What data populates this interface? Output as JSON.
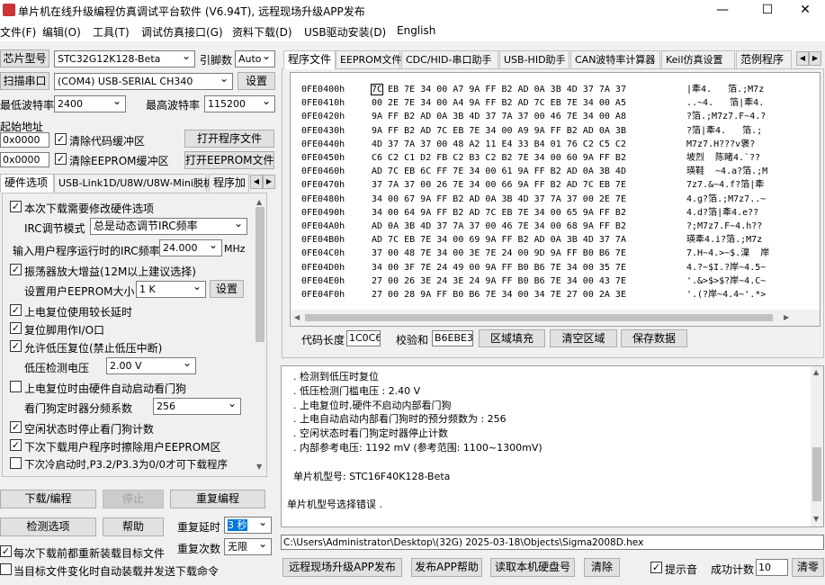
{
  "window": {
    "title": "单片机在线升级编程仿真调试平台软件 (V6.94T), 远程现场升级APP发布",
    "minimize": "—",
    "maximize": "☐",
    "close": "✕"
  },
  "menu": [
    "文件(F)",
    "编辑(O)",
    "工具(T)",
    "调试仿真接口(G)",
    "资料下载(D)",
    "USB驱动安装(D)",
    "English"
  ],
  "left": {
    "chip_model_label": "芯片型号",
    "chip_model": "STC32G12K128-Beta",
    "pins_label": "引脚数",
    "pins": "Auto",
    "scan_port": "扫描串口",
    "port": "(COM4) USB-SERIAL CH340",
    "settings": "设置",
    "min_baud_label": "最低波特率",
    "min_baud": "2400",
    "max_baud_label": "最高波特率",
    "max_baud": "115200",
    "start_addr_label": "起始地址",
    "addr1": "0x0000",
    "clear_code": "清除代码缓冲区",
    "open_program": "打开程序文件",
    "addr2": "0x0000",
    "clear_eeprom": "清除EEPROM缓冲区",
    "open_eeprom": "打开EEPROM文件",
    "tabs": [
      "硬件选项",
      "USB-Link1D/U8W/U8W-Mini脱机",
      "程序加"
    ],
    "options": {
      "modify_hw": "本次下载需要修改硬件选项",
      "irc_mode_label": "IRC调节模式",
      "irc_mode": "总是动态调节IRC频率",
      "irc_freq_label": "输入用户程序运行时的IRC频率",
      "irc_freq": "24.000",
      "mhz": "MHz",
      "osc_gain": "振荡器放大增益(12M以上建议选择)",
      "eeprom_size_label": "设置用户EEPROM大小",
      "eeprom_size": "1 K",
      "eeprom_set": "设置",
      "long_reset": "上电复位使用较长延时",
      "reset_io": "复位脚用作I/O口",
      "lvd_reset": "允许低压复位(禁止低压中断)",
      "lvd_label": "低压检测电压",
      "lvd": "2.00 V",
      "wdt_auto": "上电复位时由硬件自动启动看门狗",
      "wdt_div_label": "看门狗定时器分频系数",
      "wdt_div": "256",
      "idle_wdt": "空闲状态时停止看门狗计数",
      "erase_eeprom": "下次下载用户程序时擦除用户EEPROM区",
      "cold_boot": "下次冷启动时,P3.2/P3.3为0/0才可下载程序"
    },
    "download": "下载/编程",
    "stop": "停止",
    "repeat_program": "重复编程",
    "check_options": "检测选项",
    "help": "帮助",
    "repeat_delay_label": "重复延时",
    "repeat_delay": "3 秒",
    "reload_before": "每次下载前都重新装载目标文件",
    "repeat_count_label": "重复次数",
    "repeat_count": "无限",
    "auto_load": "当目标文件变化时自动装载并发送下载命令"
  },
  "right": {
    "tabs": [
      "程序文件",
      "EEPROM文件",
      "CDC/HID-串口助手",
      "USB-HID助手",
      "CAN波特率计算器",
      "Keil仿真设置",
      "范例程序"
    ],
    "hex": [
      {
        "addr": "0FE0400h",
        "bytes": "7C EB 7E 34 00 A7 9A FF B2 AD 0A 3B 4D 37 7A 37",
        "ascii": "|牽4.   箔.;M7z"
      },
      {
        "addr": "0FE0410h",
        "bytes": "00 2E 7E 34 00 A4 9A FF B2 AD 7C EB 7E 34 00 A5",
        "ascii": "..~4.   箔|牽4."
      },
      {
        "addr": "0FE0420h",
        "bytes": "9A FF B2 AD 0A 3B 4D 37 7A 37 00 46 7E 34 00 A8",
        "ascii": "?箔.;M7z7.F~4.?"
      },
      {
        "addr": "0FE0430h",
        "bytes": "9A FF B2 AD 7C EB 7E 34 00 A9 9A FF B2 AD 0A 3B",
        "ascii": "?箔|牽4.   箔.;"
      },
      {
        "addr": "0FE0440h",
        "bytes": "4D 37 7A 37 00 48 A2 11 E4 33 B4 01 76 C2 C5 C2",
        "ascii": "M7z7.H???v褒?"
      },
      {
        "addr": "0FE0450h",
        "bytes": "C6 C2 C1 D2 FB C2 B3 C2 B2 7E 34 00 60 9A FF B2",
        "ascii": "坡烈  陈睹4.`??"
      },
      {
        "addr": "0FE0460h",
        "bytes": "AD 7C EB 6C FF 7E 34 00 61 9A FF B2 AD 0A 3B 4D",
        "ascii": "瑛鞋  ~4.a?箔.;M"
      },
      {
        "addr": "0FE0470h",
        "bytes": "37 7A 37 00 26 7E 34 00 66 9A FF B2 AD 7C EB 7E",
        "ascii": "7z7.&~4.f?箔|牽"
      },
      {
        "addr": "0FE0480h",
        "bytes": "34 00 67 9A FF B2 AD 0A 3B 4D 37 7A 37 00 2E 7E",
        "ascii": "4.g?箔.;M7z7..~"
      },
      {
        "addr": "0FE0490h",
        "bytes": "34 00 64 9A FF B2 AD 7C EB 7E 34 00 65 9A FF B2",
        "ascii": "4.d?箔|牽4.e??"
      },
      {
        "addr": "0FE04A0h",
        "bytes": "AD 0A 3B 4D 37 7A 37 00 46 7E 34 00 68 9A FF B2",
        "ascii": "?;M7z7.F~4.h??"
      },
      {
        "addr": "0FE04B0h",
        "bytes": "AD 7C EB 7E 34 00 69 9A FF B2 AD 0A 3B 4D 37 7A",
        "ascii": "瑛牽4.i?箔.;M7z"
      },
      {
        "addr": "0FE04C0h",
        "bytes": "37 00 48 7E 34 00 3E 7E 24 00 9D 9A FF B0 B6 7E",
        "ascii": "7.H~4.>~$.澟  岸"
      },
      {
        "addr": "0FE04D0h",
        "bytes": "34 00 3F 7E 24 49 00 9A FF B0 B6 7E 34 00 35 7E",
        "ascii": "4.?~$I.?岸~4.5~"
      },
      {
        "addr": "0FE04E0h",
        "bytes": "27 00 26 3E 24 3E 24 9A FF B0 B6 7E 34 00 43 7E",
        "ascii": "'.&>$>$?岸~4.C~"
      },
      {
        "addr": "0FE04F0h",
        "bytes": "27 00 28 9A FF B0 B6 7E 34 00 34 7E 27 00 2A 3E",
        "ascii": "'.(?岸~4.4~'.*>"
      }
    ],
    "code_len_label": "代码长度",
    "code_len": "1C0C6",
    "checksum_label": "校验和",
    "checksum": "B6EBE3",
    "fill": "区域填充",
    "clear_area": "清空区域",
    "save_data": "保存数据",
    "log": [
      "  . 检测到低压时复位",
      "  . 低压检测门槛电压 : 2.40 V",
      "  . 上电复位时,硬件不启动内部看门狗",
      "  . 上电自动启动内部看门狗时的预分频数为 : 256",
      "  . 空闲状态时看门狗定时器停止计数",
      "  . 内部参考电压: 1192 mV (参考范围: 1100~1300mV)",
      "",
      "  单片机型号: STC16F40K128-Beta",
      "",
      "单片机型号选择错误 ."
    ],
    "path": "C:\\Users\\Administrator\\Desktop\\(32G)  2025-03-18\\Objects\\Sigma2008D.hex",
    "remote_app": "远程现场升级APP发布",
    "publish_help": "发布APP帮助",
    "read_serial": "读取本机硬盘号",
    "clear": "清除",
    "beep": "提示音",
    "success_label": "成功计数",
    "success_count": "10",
    "reset_count": "清零"
  }
}
